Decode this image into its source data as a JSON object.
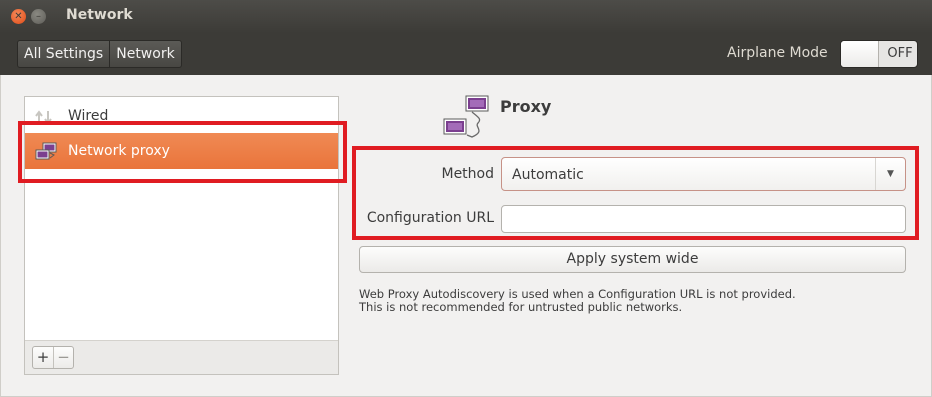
{
  "window": {
    "title": "Network"
  },
  "toolbar": {
    "breadcrumbs": [
      "All Settings",
      "Network"
    ],
    "airplane_mode_label": "Airplane Mode",
    "airplane_mode_state": "OFF"
  },
  "devices": [
    {
      "label": "Wired",
      "icon": "wired-arrows-icon",
      "selected": false
    },
    {
      "label": "Network proxy",
      "icon": "network-proxy-icon",
      "selected": true
    }
  ],
  "list_buttons": {
    "add": "+",
    "remove": "−"
  },
  "proxy": {
    "title": "Proxy",
    "method_label": "Method",
    "method_value": "Automatic",
    "config_url_label": "Configuration URL",
    "config_url_value": "",
    "apply_label": "Apply system wide",
    "hint_line1": "Web Proxy Autodiscovery is used when a Configuration URL is not provided.",
    "hint_line2": "This is not recommended for untrusted public networks."
  },
  "colors": {
    "accent": "#e9743b",
    "highlight": "#e01c22",
    "titlebar": "#3c3b37",
    "close_button": "#df4a16"
  }
}
